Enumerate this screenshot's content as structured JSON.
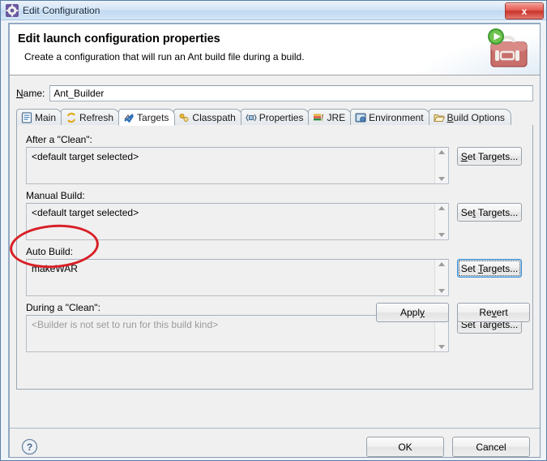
{
  "window": {
    "title": "Edit Configuration",
    "title_icon": "gear-icon",
    "close_label": "x"
  },
  "header": {
    "title": "Edit launch configuration properties",
    "subtitle": "Create a configuration that will run an Ant build file during a build.",
    "icon": "toolbox-with-run-badge-icon"
  },
  "name_field": {
    "label": "Name:",
    "mnemonic": "N",
    "value": "Ant_Builder"
  },
  "tabs": [
    {
      "label": "Main",
      "icon": "document-icon",
      "selected": false
    },
    {
      "label": "Refresh",
      "icon": "refresh-icon",
      "selected": false
    },
    {
      "label": "Targets",
      "icon": "targets-icon",
      "selected": true
    },
    {
      "label": "Classpath",
      "icon": "classpath-icon",
      "selected": false
    },
    {
      "label": "Properties",
      "icon": "properties-icon",
      "selected": false
    },
    {
      "label": "JRE",
      "icon": "jre-icon",
      "selected": false
    },
    {
      "label": "Environment",
      "icon": "environment-icon",
      "selected": false
    },
    {
      "label": "Build Options",
      "icon": "folder-icon",
      "selected": false,
      "mnemonic": "B"
    }
  ],
  "targets": {
    "groups": [
      {
        "label": "After a \"Clean\":",
        "value": "<default target selected>",
        "disabled": false,
        "button": "Set Targets...",
        "button_mnemonic": "S",
        "focused": false
      },
      {
        "label": "Manual Build:",
        "value": "<default target selected>",
        "disabled": false,
        "button": "Set Targets...",
        "button_mnemonic": "T",
        "focused": false
      },
      {
        "label": "Auto Build:",
        "value": "makeWAR",
        "disabled": false,
        "button": "Set Targets...",
        "button_mnemonic": "T",
        "focused": true
      },
      {
        "label": "During a \"Clean\":",
        "value": "<Builder is not set to run for this build kind>",
        "disabled": true,
        "button": "Set Targets...",
        "button_mnemonic": "g",
        "focused": false
      }
    ]
  },
  "buttons": {
    "apply": "Apply",
    "apply_mnemonic": "y",
    "revert": "Revert",
    "revert_mnemonic": "v",
    "ok": "OK",
    "cancel": "Cancel",
    "help_icon": "help-question-icon"
  },
  "annotation": {
    "type": "red-ellipse",
    "color": "#d81f26",
    "target": "Auto Build: makeWAR"
  },
  "colors": {
    "accent": "#3c8fd4",
    "annotation": "#d81f26",
    "disabled_text": "#9a9a9a",
    "dialog_bg": "#f0f0f0"
  }
}
